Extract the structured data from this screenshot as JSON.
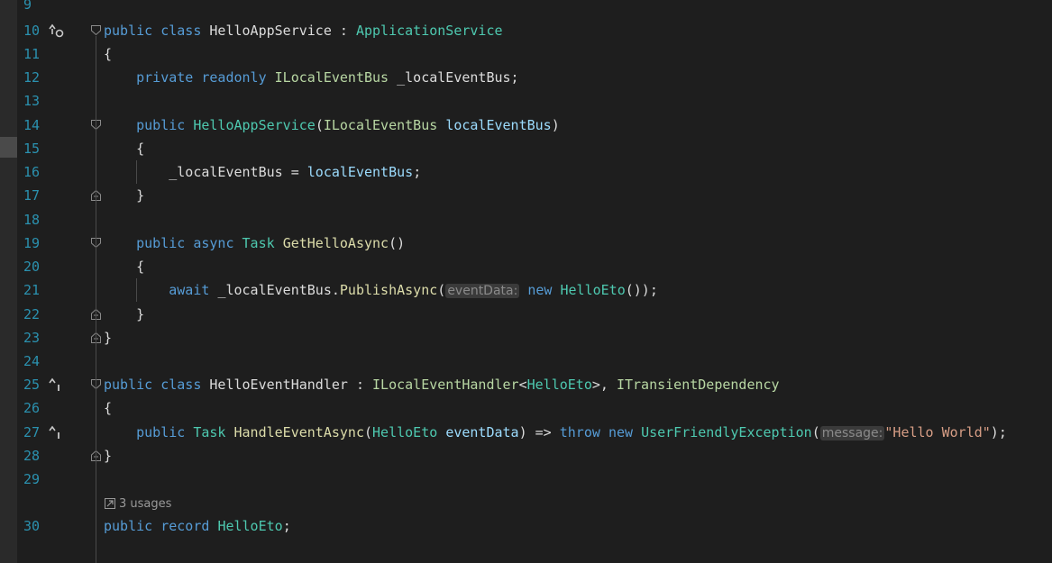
{
  "line_numbers": [
    "9",
    "10",
    "11",
    "12",
    "13",
    "14",
    "15",
    "16",
    "17",
    "18",
    "19",
    "20",
    "21",
    "22",
    "23",
    "24",
    "25",
    "26",
    "27",
    "28",
    "29",
    "30"
  ],
  "code_lens": {
    "usages": "3 usages"
  },
  "lines": [
    [],
    [
      {
        "t": "public ",
        "c": "kw"
      },
      {
        "t": "class ",
        "c": "kw"
      },
      {
        "t": "HelloAppService : ",
        "c": "pl"
      },
      {
        "t": "ApplicationService",
        "c": "ty"
      }
    ],
    [
      {
        "t": "{",
        "c": "pl"
      }
    ],
    [
      {
        "t": "    private ",
        "c": "kw"
      },
      {
        "t": "readonly ",
        "c": "kw"
      },
      {
        "t": "ILocalEventBus",
        "c": "iface"
      },
      {
        "t": " _localEventBus;",
        "c": "pl"
      }
    ],
    [],
    [
      {
        "t": "    public ",
        "c": "kw"
      },
      {
        "t": "HelloAppService",
        "c": "ty"
      },
      {
        "t": "(",
        "c": "pl"
      },
      {
        "t": "ILocalEventBus",
        "c": "iface"
      },
      {
        "t": " ",
        "c": "pl"
      },
      {
        "t": "localEventBus",
        "c": "prm"
      },
      {
        "t": ")",
        "c": "pl"
      }
    ],
    [
      {
        "t": "    {",
        "c": "pl"
      }
    ],
    [
      {
        "t": "        _localEventBus = ",
        "c": "pl"
      },
      {
        "t": "localEventBus",
        "c": "prm"
      },
      {
        "t": ";",
        "c": "pl"
      }
    ],
    [
      {
        "t": "    }",
        "c": "pl"
      }
    ],
    [],
    [
      {
        "t": "    public ",
        "c": "kw"
      },
      {
        "t": "async ",
        "c": "kw"
      },
      {
        "t": "Task",
        "c": "ty"
      },
      {
        "t": " ",
        "c": "pl"
      },
      {
        "t": "GetHelloAsync",
        "c": "mth"
      },
      {
        "t": "()",
        "c": "pl"
      }
    ],
    [
      {
        "t": "    {",
        "c": "pl"
      }
    ],
    [
      {
        "t": "        await ",
        "c": "kw"
      },
      {
        "t": "_localEventBus.",
        "c": "pl"
      },
      {
        "t": "PublishAsync",
        "c": "mth"
      },
      {
        "t": "(",
        "c": "pl"
      },
      {
        "t": "eventData:",
        "c": "hint"
      },
      {
        "t": " new ",
        "c": "kw"
      },
      {
        "t": "HelloEto",
        "c": "ty"
      },
      {
        "t": "());",
        "c": "pl"
      }
    ],
    [
      {
        "t": "    }",
        "c": "pl"
      }
    ],
    [
      {
        "t": "}",
        "c": "pl"
      }
    ],
    [],
    [
      {
        "t": "public ",
        "c": "kw"
      },
      {
        "t": "class ",
        "c": "kw"
      },
      {
        "t": "HelloEventHandler : ",
        "c": "pl"
      },
      {
        "t": "ILocalEventHandler",
        "c": "iface"
      },
      {
        "t": "<",
        "c": "pl"
      },
      {
        "t": "HelloEto",
        "c": "ty"
      },
      {
        "t": ">, ",
        "c": "pl"
      },
      {
        "t": "ITransientDependency",
        "c": "iface"
      }
    ],
    [
      {
        "t": "{",
        "c": "pl"
      }
    ],
    [
      {
        "t": "    public ",
        "c": "kw"
      },
      {
        "t": "Task",
        "c": "ty"
      },
      {
        "t": " ",
        "c": "pl"
      },
      {
        "t": "HandleEventAsync",
        "c": "mth"
      },
      {
        "t": "(",
        "c": "pl"
      },
      {
        "t": "HelloEto",
        "c": "ty"
      },
      {
        "t": " ",
        "c": "pl"
      },
      {
        "t": "eventData",
        "c": "prm"
      },
      {
        "t": ") => ",
        "c": "pl"
      },
      {
        "t": "throw ",
        "c": "kw"
      },
      {
        "t": "new ",
        "c": "kw"
      },
      {
        "t": "UserFriendlyException",
        "c": "ty"
      },
      {
        "t": "(",
        "c": "pl"
      },
      {
        "t": "message:",
        "c": "hint"
      },
      {
        "t": "\"Hello World\"",
        "c": "str"
      },
      {
        "t": ");",
        "c": "pl"
      }
    ],
    [
      {
        "t": "}",
        "c": "pl"
      }
    ],
    [],
    [
      {
        "t": "public ",
        "c": "kw"
      },
      {
        "t": "record ",
        "c": "kw"
      },
      {
        "t": "HelloEto",
        "c": "ty"
      },
      {
        "t": ";",
        "c": "pl"
      }
    ]
  ],
  "gutter_markers": {
    "10": "implemented-by-icon",
    "25": "implements-icon",
    "27": "implements-icon"
  },
  "fold_markers": {
    "10": "collapse-open-icon",
    "14": "collapse-open-icon",
    "17": "collapse-end-icon",
    "19": "collapse-open-icon",
    "22": "collapse-end-icon",
    "23": "collapse-end-icon",
    "25": "collapse-open-icon",
    "28": "collapse-end-icon"
  }
}
